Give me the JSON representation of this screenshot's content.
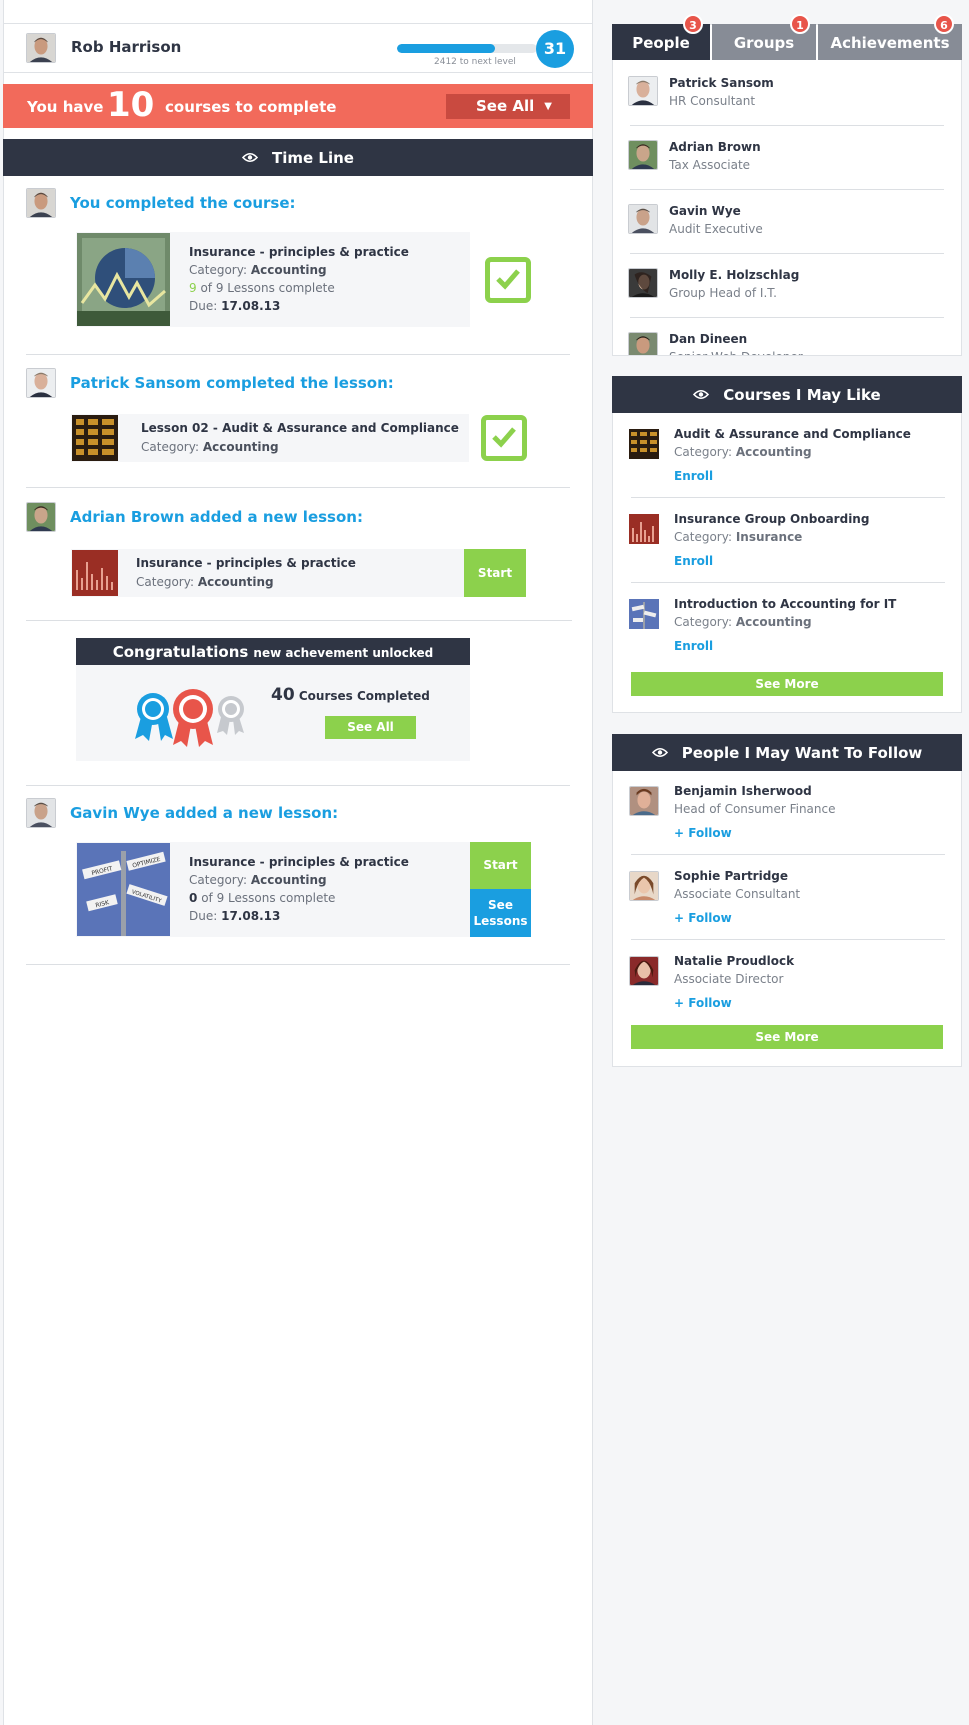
{
  "user": {
    "name": "Rob Harrison",
    "level": "31",
    "next_level_text": "2412 to next level",
    "progress": 0.7
  },
  "banner": {
    "prefix": "You have",
    "count": "10",
    "suffix": "courses to complete",
    "see_all": "See All",
    "arrow": "▼"
  },
  "timeline": {
    "title": "Time Line",
    "events": [
      {
        "title": "You completed the course:",
        "course": "Insurance - principles & practice",
        "category_label": "Category:",
        "category": "Accounting",
        "lessons_done": "9",
        "lessons_text": "of 9 Lessons complete",
        "due_label": "Due:",
        "due": "17.08.13"
      },
      {
        "title": "Patrick Sansom completed the lesson:",
        "course": "Lesson 02 - Audit & Assurance and Compliance",
        "category_label": "Category:",
        "category": "Accounting"
      },
      {
        "title": "Adrian Brown added a new lesson:",
        "course": "Insurance - principles & practice",
        "category_label": "Category:",
        "category": "Accounting",
        "button": "Start"
      },
      {
        "title": "Gavin Wye added a new lesson:",
        "course": "Insurance - principles & practice",
        "category_label": "Category:",
        "category": "Accounting",
        "lessons_done": "0",
        "lessons_text": "of 9 Lessons complete",
        "due_label": "Due:",
        "due": "17.08.13",
        "button_start": "Start",
        "button_lessons_1": "See",
        "button_lessons_2": "Lessons"
      }
    ],
    "achievement": {
      "title": "Congratulations",
      "subtitle": "new achevement unlocked",
      "count": "40",
      "count_text": "Courses Completed",
      "button": "See All"
    }
  },
  "tabs": [
    {
      "label": "People",
      "badge": "3"
    },
    {
      "label": "Groups",
      "badge": "1"
    },
    {
      "label": "Achievements",
      "badge": "6"
    }
  ],
  "people": [
    {
      "name": "Patrick Sansom",
      "role": "HR Consultant"
    },
    {
      "name": "Adrian Brown",
      "role": "Tax Associate"
    },
    {
      "name": "Gavin Wye",
      "role": "Audit Executive"
    },
    {
      "name": "Molly E. Holzschlag",
      "role": "Group Head of I.T."
    },
    {
      "name": "Dan Dineen",
      "role": "Senior Web Developer"
    }
  ],
  "courses_like": {
    "title": "Courses I May Like",
    "items": [
      {
        "name": "Audit & Assurance and Compliance",
        "category_label": "Category:",
        "category": "Accounting",
        "action": "Enroll"
      },
      {
        "name": "Insurance Group Onboarding",
        "category_label": "Category:",
        "category": "Insurance",
        "action": "Enroll"
      },
      {
        "name": "Introduction to Accounting for IT",
        "category_label": "Category:",
        "category": "Accounting",
        "action": "Enroll"
      }
    ],
    "see_more": "See More"
  },
  "follow": {
    "title": "People I May Want To Follow",
    "items": [
      {
        "name": "Benjamin Isherwood",
        "role": "Head of Consumer Finance",
        "action": "+ Follow"
      },
      {
        "name": "Sophie Partridge",
        "role": "Associate Consultant",
        "action": "+ Follow"
      },
      {
        "name": "Natalie Proudlock",
        "role": "Associate Director",
        "action": "+ Follow"
      }
    ],
    "see_more": "See More"
  },
  "signpost": [
    "PROFIT",
    "OPTIMIZE",
    "VOLATILITY",
    "RISK"
  ],
  "colors": {
    "accent": "#1a9ee0",
    "green": "#8cd14c",
    "banner": "#f26a5b",
    "dark": "#2f3544",
    "badge": "#e8554a"
  },
  "icons": [
    "eye-icon",
    "check-icon",
    "ribbon-icon"
  ]
}
